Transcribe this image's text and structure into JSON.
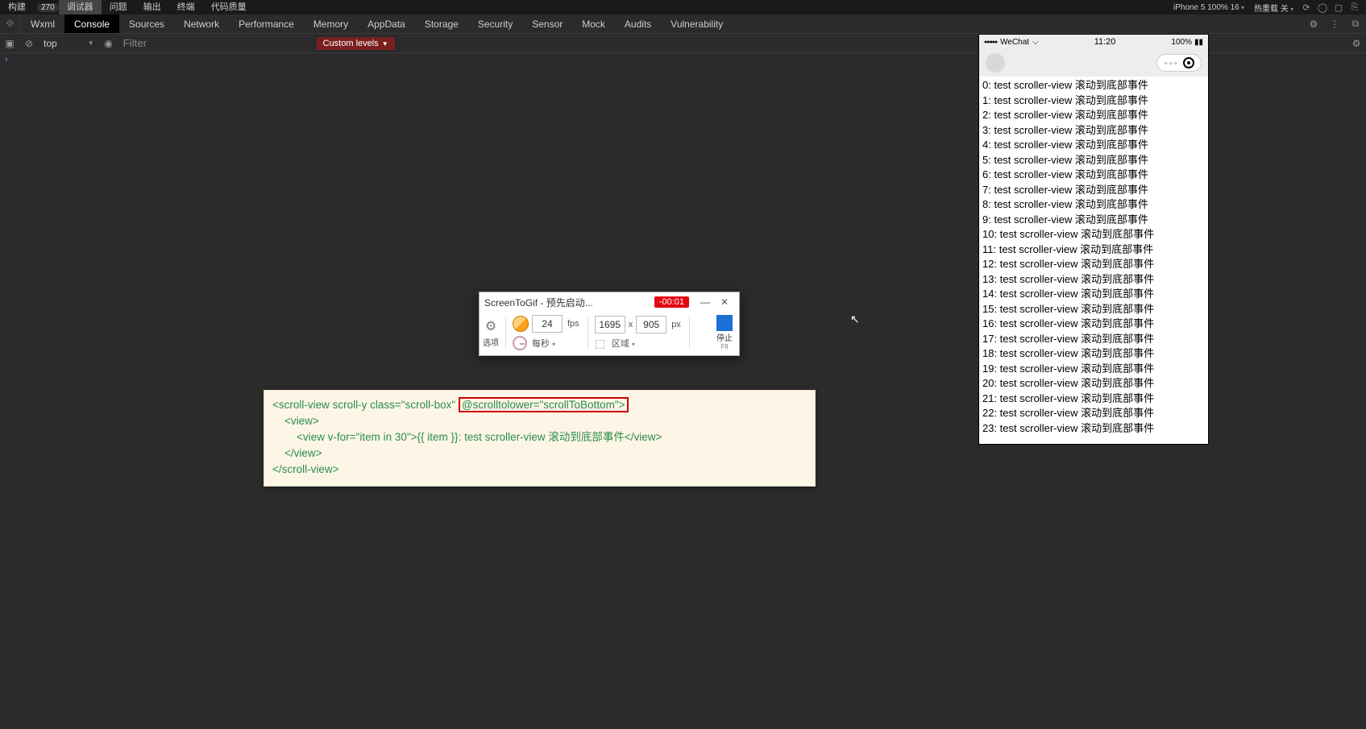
{
  "ide_menu": {
    "items": [
      "构建",
      "调试器",
      "问题",
      "输出",
      "终端",
      "代码质量"
    ],
    "counter": "270",
    "active_index": 1
  },
  "right_strip": {
    "device_label": "iPhone 5 100% 16",
    "status_label": "热重载 关"
  },
  "dev_tabs": {
    "tabs": [
      "Wxml",
      "Console",
      "Sources",
      "Network",
      "Performance",
      "Memory",
      "AppData",
      "Storage",
      "Security",
      "Sensor",
      "Mock",
      "Audits",
      "Vulnerability"
    ],
    "active_index": 1
  },
  "console_tb": {
    "context": "top",
    "filter_placeholder": "Filter",
    "levels_label": "Custom levels"
  },
  "screentogif": {
    "title": "ScreenToGif - 预先启动...",
    "timer": "-00:01",
    "options_label": "选项",
    "fps_value": "24",
    "fps_unit": "fps",
    "per_sec_label": "每秒",
    "width": "1695",
    "height": "905",
    "px_unit": "px",
    "area_label": "区域",
    "stop_label": "停止",
    "stop_hotkey": "F8"
  },
  "code": {
    "l1a": "<scroll-view scroll-y class=\"scroll-box\" ",
    "l1b": "@scrolltolower=\"scrollToBottom\">",
    "l2": "    <view>",
    "l3": "        <view v-for=\"item in 30\">{{ item }}: test scroller-view 滚动到底部事件</view>",
    "l4": "    </view>",
    "l5": "</scroll-view>"
  },
  "phone": {
    "carrier_dots": "●●●●●",
    "carrier": "WeChat",
    "time": "11:20",
    "battery": "100%",
    "list_prefix_suffix": ": test scroller-view 滚动到底部事件",
    "list_count": 24
  }
}
